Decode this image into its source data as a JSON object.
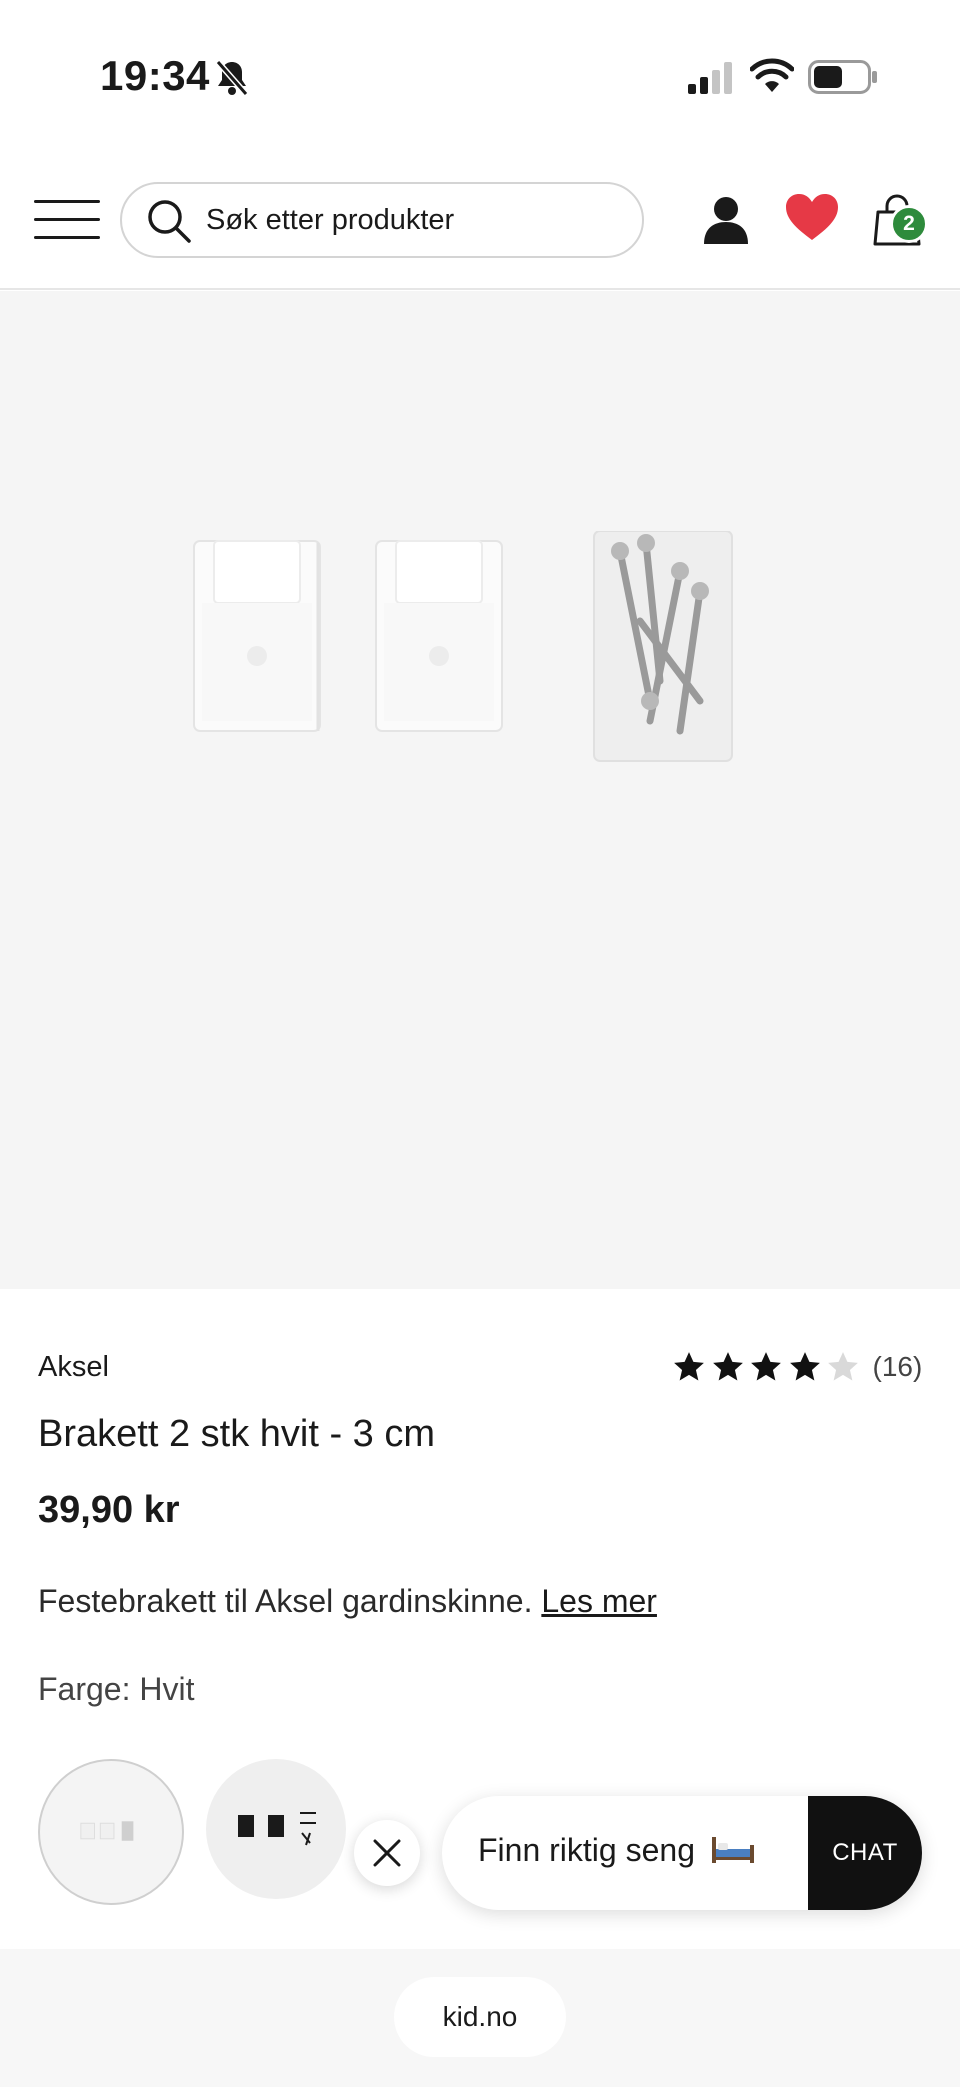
{
  "status_bar": {
    "time": "19:34"
  },
  "header": {
    "search": {
      "placeholder": "Søk etter produkter"
    },
    "cart_count": "2",
    "colors": {
      "wishlist": "#e63946",
      "cart_badge": "#2e8b3c"
    }
  },
  "product": {
    "brand": "Aksel",
    "rating_value": 4,
    "rating_max": 5,
    "review_count": "(16)",
    "title": "Brakett 2 stk hvit - 3 cm",
    "price": "39,90 kr",
    "description": "Festebrakett til Aksel gardinskinne.",
    "read_more": "Les mer",
    "color_label": "Farge:",
    "color_value": "Hvit"
  },
  "chat": {
    "prompt": "Finn riktig seng",
    "button": "CHAT"
  },
  "footer": {
    "domain": "kid.no"
  }
}
